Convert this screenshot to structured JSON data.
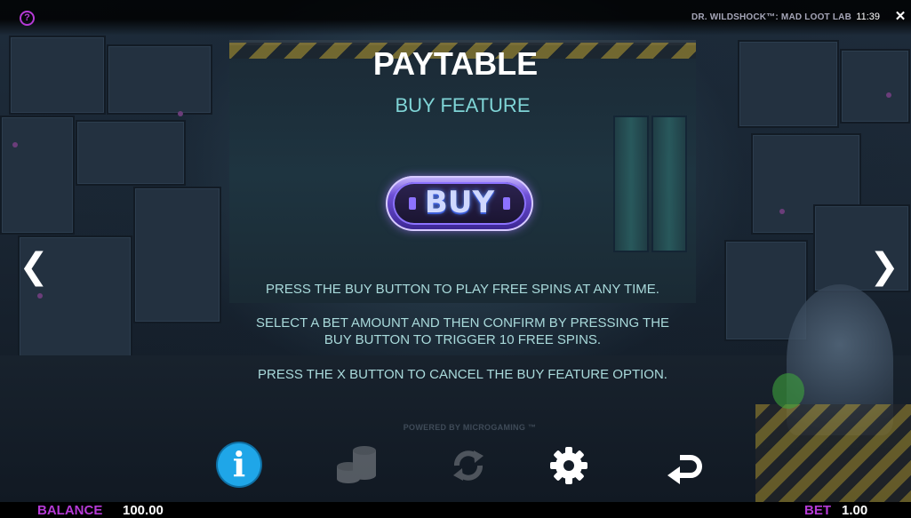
{
  "top_bar": {
    "help_icon": "question-mark-circle-icon",
    "help_glyph": "?",
    "game_title": "DR. WILDSHOCK™: MAD LOOT LAB",
    "time": "11:39",
    "close_icon": "close-x-icon",
    "close_glyph": "✕"
  },
  "paytable": {
    "title": "PAYTABLE",
    "subtitle": "BUY FEATURE",
    "buy_button_label": "BUY",
    "instructions": [
      "PRESS THE BUY BUTTON TO PLAY FREE SPINS AT ANY TIME.",
      "SELECT A BET AMOUNT AND THEN CONFIRM BY PRESSING THE",
      "BUY BUTTON TO TRIGGER 10 FREE SPINS.",
      "PRESS THE X BUTTON TO CANCEL THE BUY FEATURE OPTION."
    ]
  },
  "navigation": {
    "prev_icon": "chevron-left-icon",
    "prev_glyph": "❮",
    "next_icon": "chevron-right-icon",
    "next_glyph": "❯"
  },
  "footer": {
    "powered_by": "POWERED BY MICROGAMING ™"
  },
  "toolbar": {
    "info_icon": "info-icon",
    "info_glyph": "i",
    "coins_icon": "coin-stack-icon",
    "autoplay_icon": "autoplay-cycle-icon",
    "settings_icon": "gear-icon",
    "back_icon": "return-arrow-icon"
  },
  "status": {
    "balance_label": "BALANCE",
    "balance_value": "100.00",
    "bet_label": "BET",
    "bet_value": "1.00"
  },
  "colors": {
    "accent_purple": "#b53ad6",
    "info_blue": "#1fa6e8",
    "subtitle_teal": "#7fd4d6",
    "instruction_text": "#a9dadb"
  }
}
